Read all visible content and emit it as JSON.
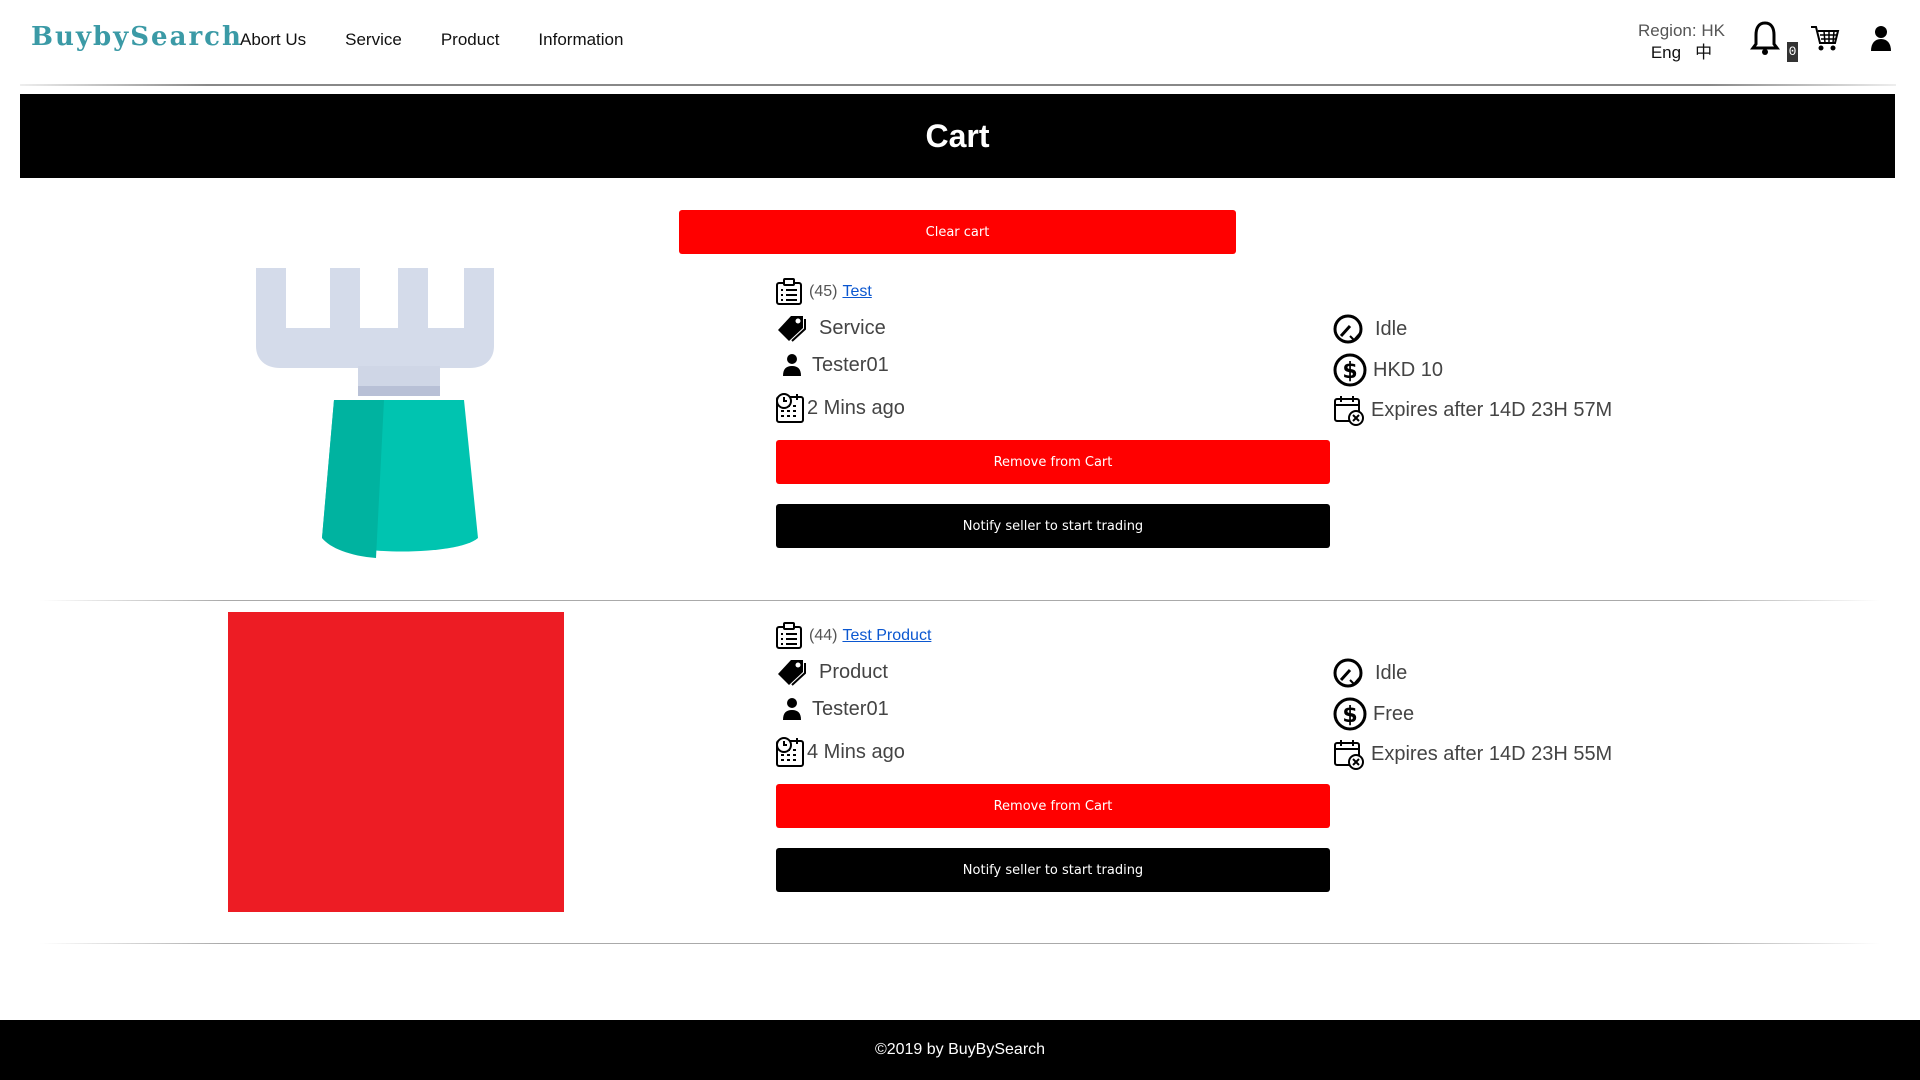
{
  "header": {
    "logo": "BuybySearch",
    "nav": [
      "Abort Us",
      "Service",
      "Product",
      "Information"
    ],
    "region_label": "Region: HK",
    "lang_en": "Eng",
    "lang_zh": "中",
    "notification_count": "0"
  },
  "page_title": "Cart",
  "clear_cart_label": "Clear cart",
  "items": [
    {
      "id": "(45)",
      "name": "Test",
      "type": "Service",
      "seller": "Tester01",
      "posted": "2 Mins ago",
      "status": "Idle",
      "price": "HKD 10",
      "expires": "Expires after 14D 23H 57M",
      "remove_label": "Remove from Cart",
      "notify_label": "Notify seller to start trading"
    },
    {
      "id": "(44)",
      "name": "Test Product",
      "type": "Product",
      "seller": "Tester01",
      "posted": "4 Mins ago",
      "status": "Idle",
      "price": "Free",
      "expires": "Expires after 14D 23H 55M",
      "remove_label": "Remove from Cart",
      "notify_label": "Notify seller to start trading"
    }
  ],
  "footer": "©2019 by BuyBySearch",
  "colors": {
    "primary_red": "#ff0000",
    "black": "#000000",
    "link": "#0b57d0",
    "product_image": "#ed1c24"
  }
}
